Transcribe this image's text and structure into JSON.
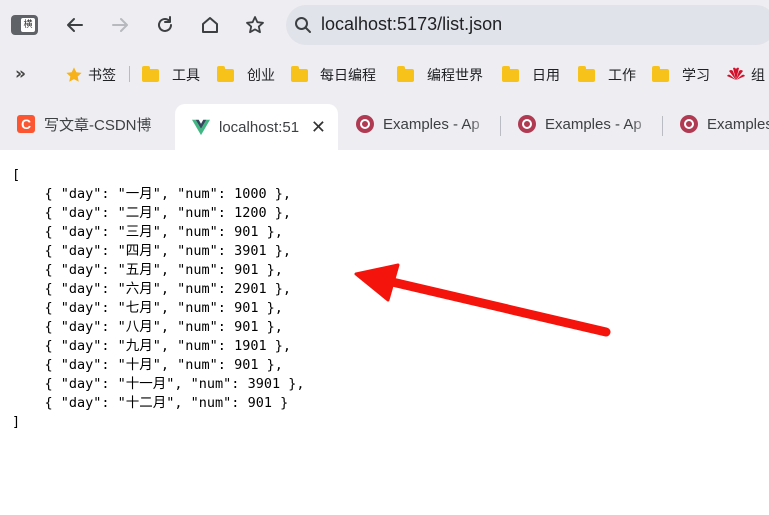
{
  "browser": {
    "address": "localhost:5173/list.json",
    "nav_icons": [
      "back-icon",
      "forward-icon",
      "reload-icon",
      "home-icon",
      "star-icon"
    ],
    "win_icon_text": "横"
  },
  "bookmarks": {
    "chevron": "»",
    "items": [
      {
        "label": "书签",
        "icon": "star-icon"
      },
      {
        "label": "工具",
        "icon": "folder-icon"
      },
      {
        "label": "创业",
        "icon": "folder-icon"
      },
      {
        "label": "每日编程",
        "icon": "folder-icon"
      },
      {
        "label": "编程世界",
        "icon": "folder-icon"
      },
      {
        "label": "日用",
        "icon": "folder-icon"
      },
      {
        "label": "工作",
        "icon": "folder-icon"
      },
      {
        "label": "学习",
        "icon": "folder-icon"
      },
      {
        "label": "组",
        "icon": "huawei-icon"
      }
    ]
  },
  "tabs": [
    {
      "title": "写文章-CSDN博",
      "favicon": "csdn-icon",
      "active": false
    },
    {
      "title": "localhost:51",
      "favicon": "vue-icon",
      "active": true
    },
    {
      "title": "Examples - Ap",
      "favicon": "q-icon",
      "active": false
    },
    {
      "title": "Examples - Ap",
      "favicon": "q-icon",
      "active": false
    },
    {
      "title": "Examples",
      "favicon": "q-icon",
      "active": false
    }
  ],
  "json_lines": [
    "[",
    "    { \"day\": \"一月\", \"num\": 1000 },",
    "    { \"day\": \"二月\", \"num\": 1200 },",
    "    { \"day\": \"三月\", \"num\": 901 },",
    "    { \"day\": \"四月\", \"num\": 3901 },",
    "    { \"day\": \"五月\", \"num\": 901 },",
    "    { \"day\": \"六月\", \"num\": 2901 },",
    "    { \"day\": \"七月\", \"num\": 901 },",
    "    { \"day\": \"八月\", \"num\": 901 },",
    "    { \"day\": \"九月\", \"num\": 1901 },",
    "    { \"day\": \"十月\", \"num\": 901 },",
    "    { \"day\": \"十一月\", \"num\": 3901 },",
    "    { \"day\": \"十二月\", \"num\": 901 }",
    "]"
  ],
  "colors": {
    "chrome_bg": "#eeeef2",
    "omnibox_bg": "#e1e3ea",
    "folder": "#f7c31a",
    "annotation_arrow": "#f5140c"
  }
}
